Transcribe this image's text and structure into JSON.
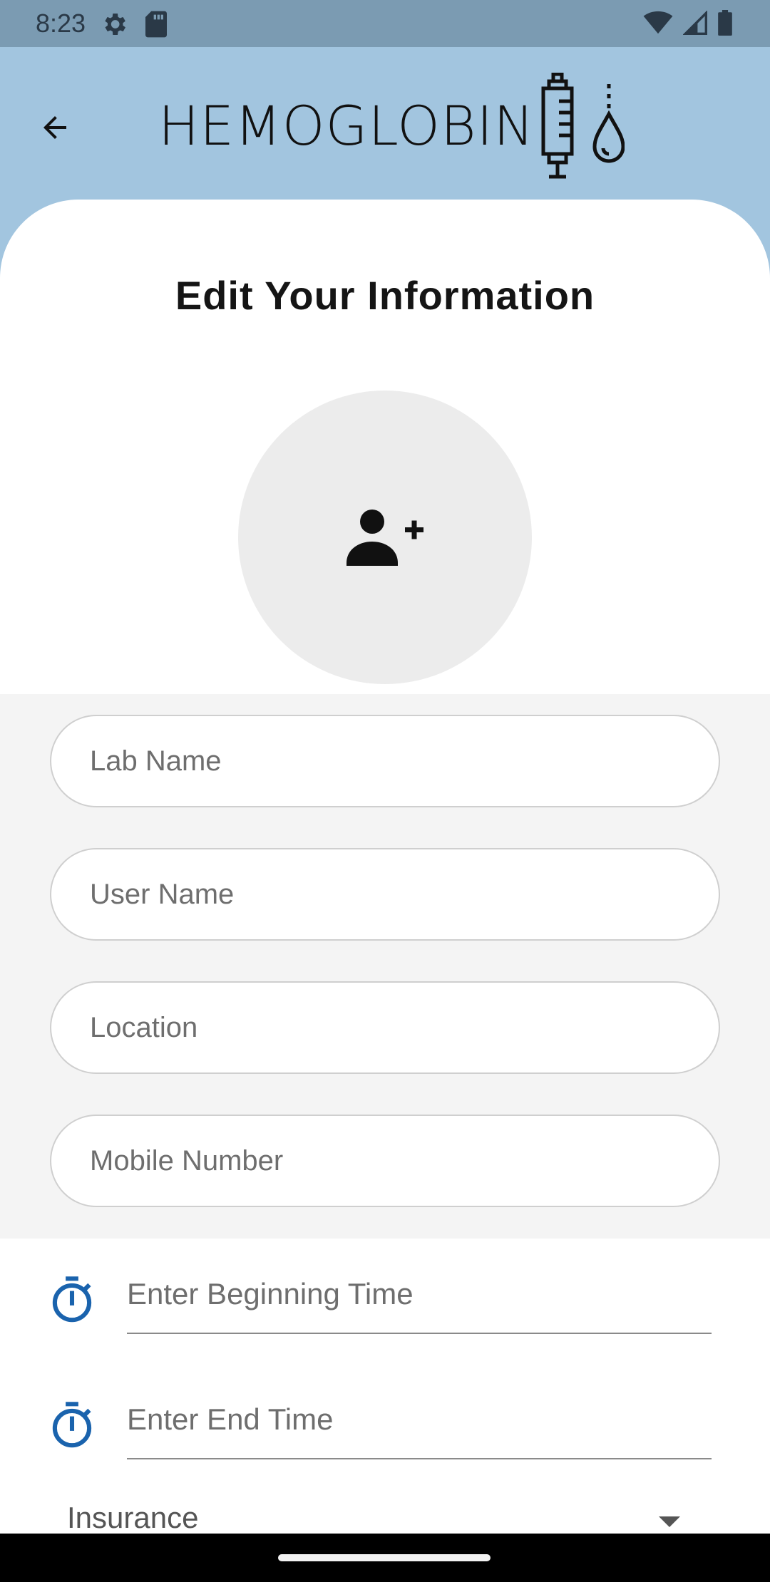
{
  "status_bar": {
    "time": "8:23",
    "left_icons": [
      "settings-icon",
      "sd-card-icon"
    ],
    "right_icons": [
      "wifi-icon",
      "signal-icon",
      "battery-icon"
    ]
  },
  "app_bar": {
    "brand_name": "HEMOGLOBIN",
    "logo_icon": "syringe-drop-icon",
    "back_icon": "arrow-back-icon"
  },
  "page": {
    "title": "Edit Your Information",
    "avatar_icon": "person-add-icon"
  },
  "form": {
    "lab_name": {
      "placeholder": "Lab Name",
      "value": ""
    },
    "user_name": {
      "placeholder": "User Name",
      "value": ""
    },
    "location": {
      "placeholder": "Location",
      "value": ""
    },
    "mobile_number": {
      "placeholder": "Mobile Number",
      "value": ""
    },
    "begin_time": {
      "placeholder": "Enter Beginning Time",
      "icon": "timer-icon"
    },
    "end_time": {
      "placeholder": "Enter End Time",
      "icon": "timer-icon"
    },
    "insurance": {
      "label": "Insurance",
      "icon": "dropdown-arrow-icon"
    }
  },
  "colors": {
    "app_bar_bg": "#a2c5df",
    "status_bar_bg": "#7b9bb2",
    "accent_blue": "#1a63ad",
    "avatar_bg": "#ececec"
  }
}
